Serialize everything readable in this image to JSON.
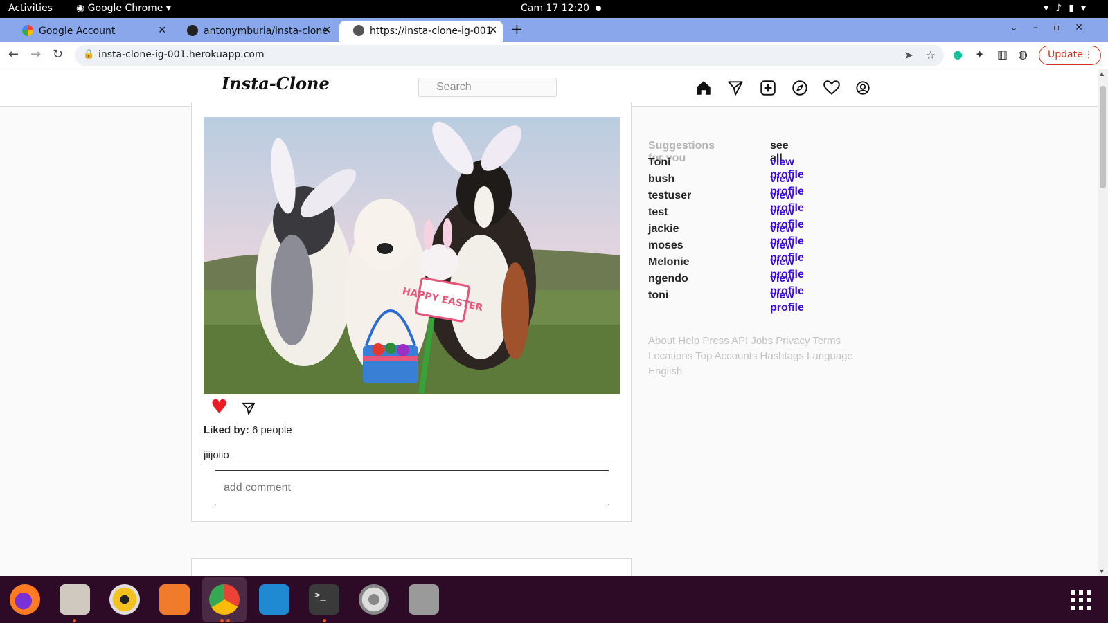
{
  "os_bar": {
    "activities": "Activities",
    "app_name": "Google Chrome",
    "clock": "Cam 17  12:20"
  },
  "tabs": [
    {
      "title": "Google Account",
      "active": false
    },
    {
      "title": "antonymburia/insta-clone",
      "active": false
    },
    {
      "title": "https://insta-clone-ig-001",
      "active": true
    }
  ],
  "address_bar": {
    "url": "insta-clone-ig-001.herokuapp.com",
    "update_label": "Update"
  },
  "site": {
    "logo": "Insta-Clone",
    "search_placeholder": "Search"
  },
  "post": {
    "liked_by_label": "Liked by:",
    "liked_by_value": "6 people",
    "caption": "jiijoiio",
    "comment_placeholder": "add comment",
    "photo_sign_text": "HAPPY EASTER"
  },
  "suggestions": {
    "heading": "Suggestions for you",
    "see_all": "see all",
    "items": [
      {
        "name": "Toni",
        "link": "view profile"
      },
      {
        "name": "bush",
        "link": "view profile"
      },
      {
        "name": "testuser",
        "link": "view profile"
      },
      {
        "name": "test",
        "link": "view profile"
      },
      {
        "name": "jackie",
        "link": "view profile"
      },
      {
        "name": "moses",
        "link": "view profile"
      },
      {
        "name": "Melonie",
        "link": "view profile"
      },
      {
        "name": "ngendo",
        "link": "view profile"
      },
      {
        "name": "toni",
        "link": "view profile"
      }
    ]
  },
  "footer_text": "About Help Press API Jobs Privacy Terms Locations Top Accounts Hashtags Language English",
  "colors": {
    "like": "#ed1c24",
    "link": "#3a0ce0",
    "dock": "#2d0b26",
    "tabstrip": "#8aa7ec"
  },
  "dock_apps": [
    "firefox-icon",
    "files-icon",
    "rhythmbox-icon",
    "software-icon",
    "chrome-icon",
    "vscode-icon",
    "terminal-icon",
    "settings-icon",
    "disks-icon"
  ]
}
